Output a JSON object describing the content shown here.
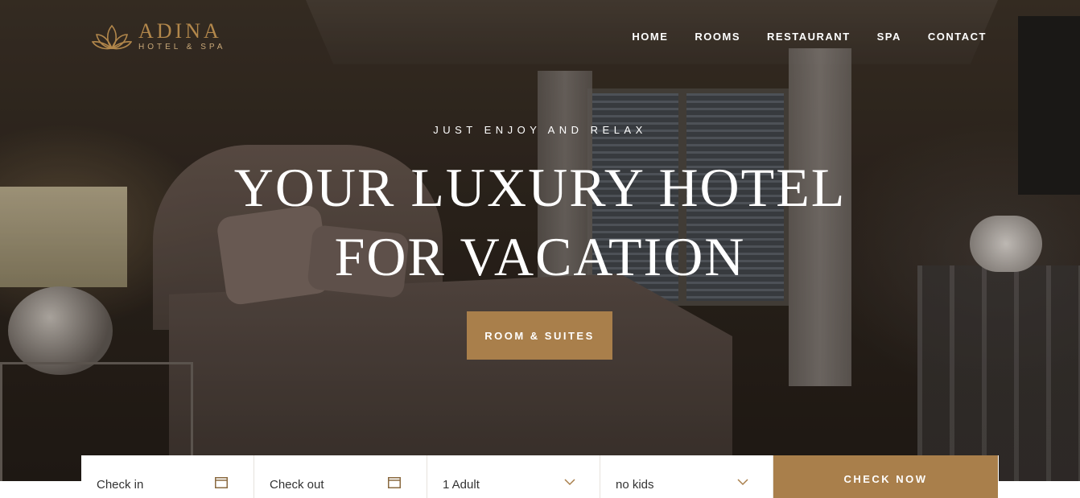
{
  "brand": {
    "name": "ADINA",
    "tagline": "HOTEL & SPA",
    "accent": "#a97f4b"
  },
  "nav": {
    "items": [
      {
        "label": "HOME"
      },
      {
        "label": "ROOMS"
      },
      {
        "label": "RESTAURANT"
      },
      {
        "label": "SPA"
      },
      {
        "label": "CONTACT"
      }
    ]
  },
  "hero": {
    "eyebrow": "JUST ENJOY AND RELAX",
    "title_line1": "YOUR LUXURY HOTEL",
    "title_line2": "FOR VACATION",
    "cta_label": "ROOM & SUITES"
  },
  "booking": {
    "check_in": {
      "label": "Check in",
      "icon": "calendar-icon"
    },
    "check_out": {
      "label": "Check out",
      "icon": "calendar-icon"
    },
    "adults": {
      "value": "1 Adult",
      "icon": "chevron-down-icon"
    },
    "kids": {
      "value": "no kids",
      "icon": "chevron-down-icon"
    },
    "submit_label": "CHECK NOW"
  }
}
